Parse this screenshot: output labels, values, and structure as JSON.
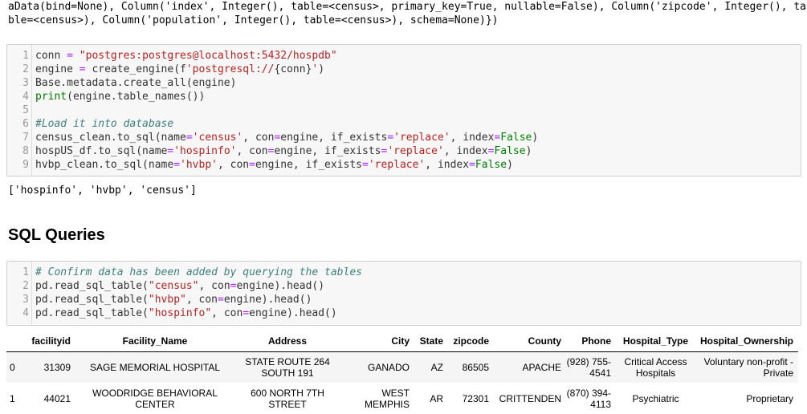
{
  "output_top": {
    "line1": "aData(bind=None), Column('index', Integer(), table=<census>, primary_key=True, nullable=False), Column('zipcode', Integer(), ta",
    "line2": "ble=<census>), Column('population', Integer(), table=<census>), schema=None)})"
  },
  "cell1": {
    "line_numbers": [
      "1",
      "2",
      "3",
      "4",
      "5",
      "6",
      "7",
      "8",
      "9"
    ],
    "l1": {
      "a": "conn ",
      "b": "=",
      "c": " ",
      "d": "\"postgres:postgres@localhost:5432/hospdb\""
    },
    "l2": {
      "a": "engine ",
      "b": "=",
      "c": " create_engine(f",
      "d": "'postgresql://",
      "e": "{conn}",
      "f": "'",
      "g": ")"
    },
    "l3": {
      "a": "Base.metadata.create_all(engine)"
    },
    "l4": {
      "a": "print",
      "b": "(engine.table_names())"
    },
    "l6": {
      "a": "#Load it into database"
    },
    "l7": {
      "a": "census_clean.to_sql(name",
      "b": "=",
      "c": "'census'",
      "d": ", con",
      "e": "=",
      "f": "engine, if_exists",
      "g": "=",
      "h": "'replace'",
      "i": ", index",
      "j": "=",
      "k": "False",
      "l": ")"
    },
    "l8": {
      "a": "hospUS_df.to_sql(name",
      "b": "=",
      "c": "'hospinfo'",
      "d": ", con",
      "e": "=",
      "f": "engine, if_exists",
      "g": "=",
      "h": "'replace'",
      "i": ", index",
      "j": "=",
      "k": "False",
      "l": ")"
    },
    "l9": {
      "a": "hvbp_clean.to_sql(name",
      "b": "=",
      "c": "'hvbp'",
      "d": ", con",
      "e": "=",
      "f": "engine, if_exists",
      "g": "=",
      "h": "'replace'",
      "i": ", index",
      "j": "=",
      "k": "False",
      "l": ")"
    }
  },
  "output_mid": "['hospinfo', 'hvbp', 'census']",
  "section_title": "SQL Queries",
  "cell2": {
    "line_numbers": [
      "1",
      "2",
      "3",
      "4"
    ],
    "l1": {
      "a": "# Confirm data has been added by querying the tables"
    },
    "l2": {
      "a": "pd.read_sql_table(",
      "b": "\"census\"",
      "c": ", con",
      "d": "=",
      "e": "engine).head()"
    },
    "l3": {
      "a": "pd.read_sql_table(",
      "b": "\"hvbp\"",
      "c": ", con",
      "d": "=",
      "e": "engine).head()"
    },
    "l4": {
      "a": "pd.read_sql_table(",
      "b": "\"hospinfo\"",
      "c": ", con",
      "d": "=",
      "e": "engine).head()"
    }
  },
  "table": {
    "columns": [
      "",
      "facilityid",
      "Facility_Name",
      "Address",
      "City",
      "State",
      "zipcode",
      "County",
      "Phone",
      "Hospital_Type",
      "Hospital_Ownership"
    ],
    "rows": [
      [
        "0",
        "31309",
        "SAGE MEMORIAL HOSPITAL",
        "STATE ROUTE 264 SOUTH 191",
        "GANADO",
        "AZ",
        "86505",
        "APACHE",
        "(928) 755-4541",
        "Critical Access Hospitals",
        "Voluntary non-profit - Private"
      ],
      [
        "1",
        "44021",
        "WOODRIDGE BEHAVIORAL CENTER",
        "600 NORTH 7TH STREET",
        "WEST MEMPHIS",
        "AR",
        "72301",
        "CRITTENDEN",
        "(870) 394-4113",
        "Psychiatric",
        "Proprietary"
      ]
    ]
  }
}
